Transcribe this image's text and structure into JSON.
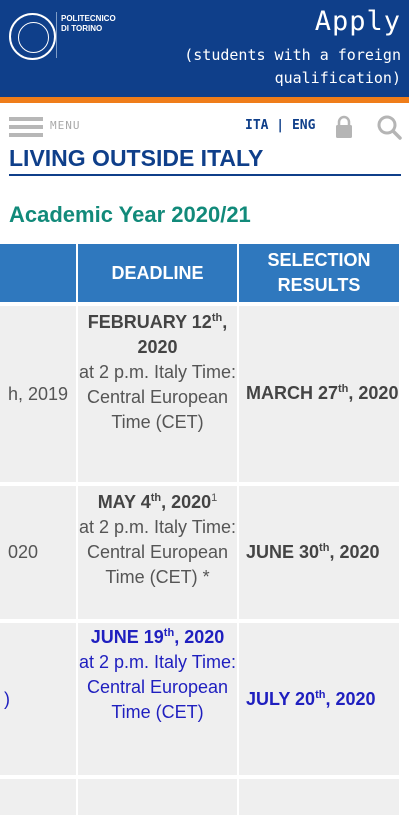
{
  "header": {
    "logo_text": "POLITECNICO DI TORINO",
    "apply_title": "Apply",
    "apply_subtitle": "(students with a foreign qualification)"
  },
  "nav": {
    "menu_label": "MENU",
    "lang_label": "ITA | ENG"
  },
  "section_title": "LIVING OUTSIDE ITALY",
  "year_title": "Academic Year 2020/21",
  "table": {
    "headers": [
      "DEADLINE",
      "SELECTION RESULTS"
    ],
    "rows": [
      {
        "first_col": "h, 2019",
        "deadline_date": "FEBRUARY 12",
        "deadline_sup": "th",
        "deadline_year": ", 2020",
        "deadline_time": "at 2 p.m.",
        "deadline_tz": " Italy Time: Central European Time (CET)",
        "result_date": "MARCH 27",
        "result_sup": "th",
        "result_year": ", 2020"
      },
      {
        "first_col": "020",
        "deadline_date": "MAY 4",
        "deadline_sup": "th",
        "deadline_year": ", 2020",
        "deadline_note": "1",
        "deadline_time": "at 2 p.m.",
        "deadline_tz": " Italy Time: Central European Time (CET) *",
        "result_date": "JUNE 30",
        "result_sup": "th",
        "result_year": ", 2020"
      },
      {
        "first_col": ")",
        "deadline_date": "JUNE 19",
        "deadline_sup": "th",
        "deadline_year": ", 2020",
        "deadline_time": "at 2 p.m.",
        "deadline_tz": " Italy Time: Central European Time (CET)",
        "result_date": "JULY 20",
        "result_sup": "th",
        "result_year": ", 2020"
      }
    ]
  }
}
